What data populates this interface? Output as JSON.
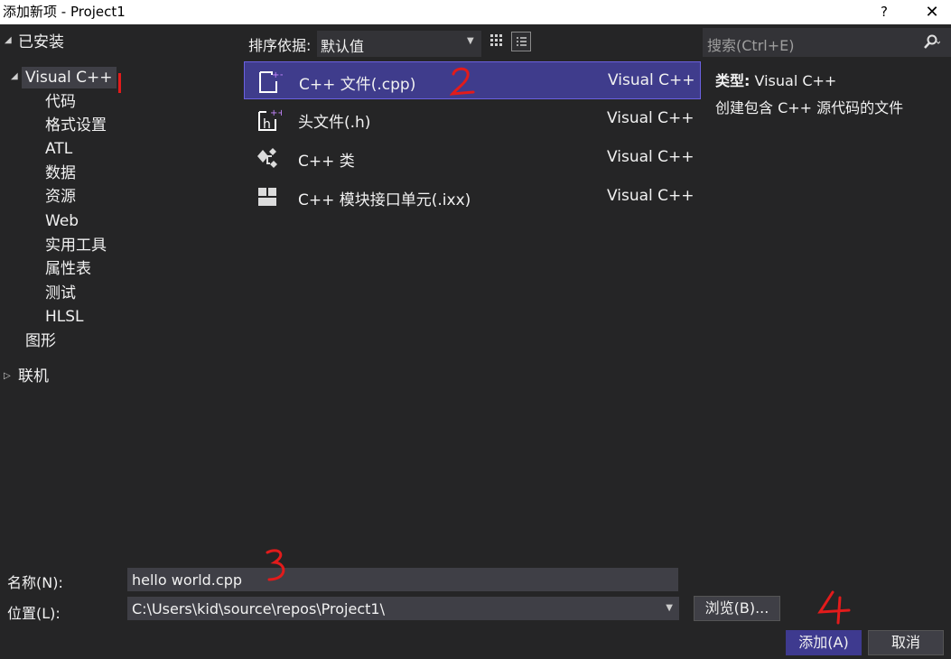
{
  "window": {
    "title": "添加新项 - Project1",
    "help": "?",
    "close": "✕"
  },
  "tree": {
    "installed": "已安装",
    "visual_cpp": "Visual C++",
    "children": [
      "代码",
      "格式设置",
      "ATL",
      "数据",
      "资源",
      "Web",
      "实用工具",
      "属性表",
      "测试",
      "HLSL"
    ],
    "graphics": "图形",
    "online": "联机"
  },
  "sort": {
    "label": "排序依据:",
    "value": "默认值"
  },
  "search": {
    "placeholder": "搜索(Ctrl+E)"
  },
  "templates": [
    {
      "name": "C++ 文件(.cpp)",
      "lang": "Visual C++",
      "icon": "cpp-file-icon",
      "selected": true
    },
    {
      "name": "头文件(.h)",
      "lang": "Visual C++",
      "icon": "header-file-icon",
      "selected": false
    },
    {
      "name": "C++ 类",
      "lang": "Visual C++",
      "icon": "cpp-class-icon",
      "selected": false
    },
    {
      "name": "C++ 模块接口单元(.ixx)",
      "lang": "Visual C++",
      "icon": "module-interface-icon",
      "selected": false
    }
  ],
  "info": {
    "type_label": "类型:",
    "type_value": "Visual C++",
    "description": "创建包含 C++ 源代码的文件"
  },
  "form": {
    "name_label": "名称(N):",
    "name_value": "hello world.cpp",
    "location_label": "位置(L):",
    "location_value": "C:\\Users\\kid\\source\\repos\\Project1\\",
    "browse": "浏览(B)...",
    "add": "添加(A)",
    "cancel": "取消"
  },
  "colors": {
    "background": "#252526",
    "selection": "#3f3c8c",
    "annotation": "#e21b1b"
  }
}
